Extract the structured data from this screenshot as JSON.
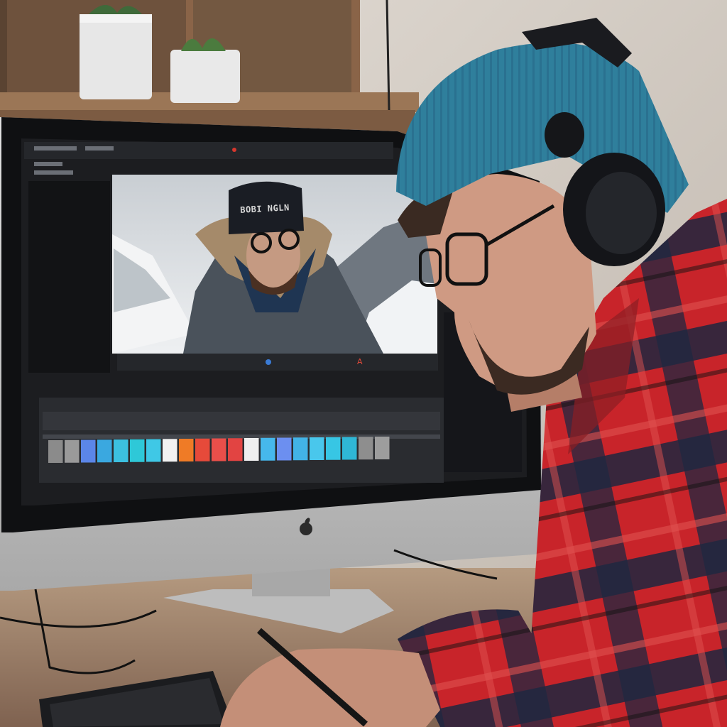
{
  "photo": {
    "subject": "video-editing-workstation",
    "preview_beanie_text": "BOBI NGLN",
    "colors": {
      "wall": "#d9d3cb",
      "shelf_wood": "#8a6448",
      "monitor_silver": "#c9c9c9",
      "monitor_bezel": "#0f1012",
      "editor_bg": "#1c1d20",
      "beanie_blue": "#2f7f9c",
      "flannel_red": "#c8242a",
      "flannel_navy": "#1f2740",
      "desk_wood": "#9a7b60"
    },
    "timeline_swatches": [
      "#8b8b8b",
      "#9a9a9a",
      "#5b86e8",
      "#3aa8e0",
      "#3cc0e0",
      "#2ec8d8",
      "#3fc8e6",
      "#f2f2f2",
      "#ef7b26",
      "#e64a3a",
      "#ea4f4a",
      "#e24442",
      "#efefef",
      "#46b8ec",
      "#6c8ff0",
      "#42b3e6",
      "#49c7ec",
      "#37c6e4",
      "#2fb7d6",
      "#8e8e8e",
      "#9d9d9d"
    ]
  }
}
